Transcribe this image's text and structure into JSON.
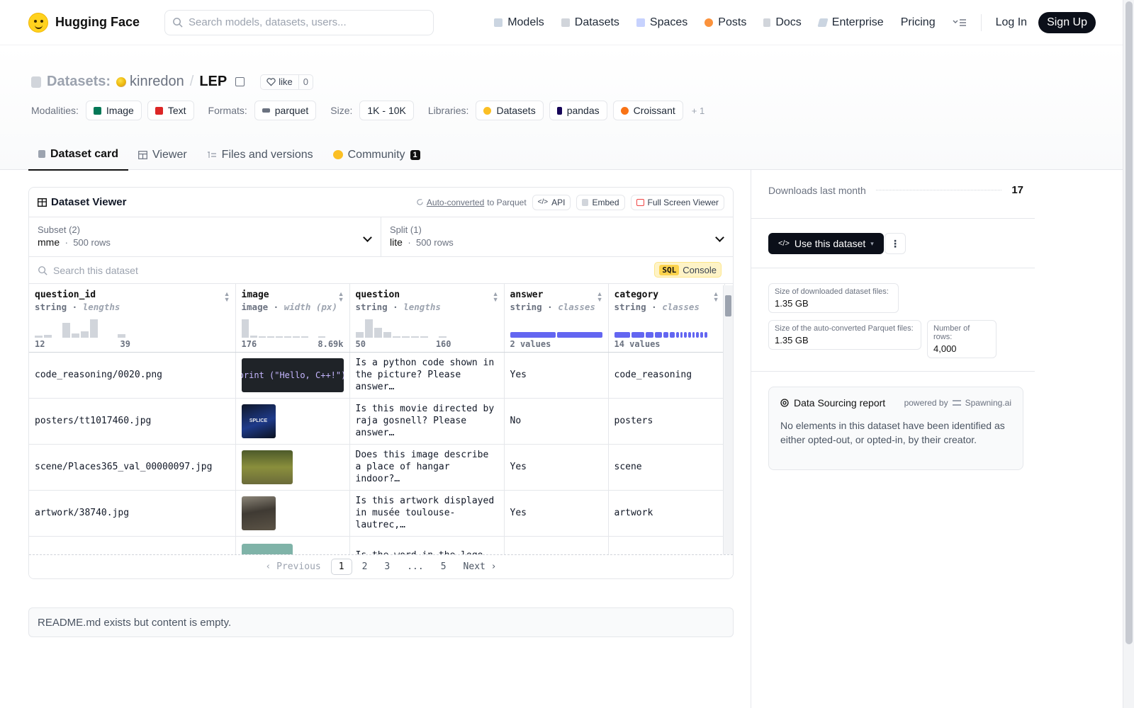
{
  "brand": {
    "name": "Hugging Face"
  },
  "search": {
    "placeholder": "Search models, datasets, users..."
  },
  "nav": {
    "items": [
      {
        "label": "Models",
        "color": "#a5b4fc"
      },
      {
        "label": "Datasets",
        "color": "#d1d5db"
      },
      {
        "label": "Spaces",
        "color": "#c7d2fe"
      },
      {
        "label": "Posts",
        "color": "#fb923c"
      },
      {
        "label": "Docs",
        "color": "#d1d5db"
      },
      {
        "label": "Enterprise",
        "color": "#cbd5e1"
      },
      {
        "label": "Pricing",
        "color": ""
      }
    ],
    "login": "Log In",
    "signup": "Sign Up"
  },
  "dataset": {
    "section": "Datasets:",
    "owner": "kinredon",
    "separator": "/",
    "name": "LEP",
    "like_label": "like",
    "likes": "0"
  },
  "tags": {
    "modalities_label": "Modalities:",
    "modalities": [
      "Image",
      "Text"
    ],
    "formats_label": "Formats:",
    "formats": [
      "parquet"
    ],
    "size_label": "Size:",
    "size": "1K - 10K",
    "libraries_label": "Libraries:",
    "libraries": [
      "Datasets",
      "pandas",
      "Croissant"
    ],
    "more": "+ 1"
  },
  "tabs": [
    {
      "label": "Dataset card",
      "active": true
    },
    {
      "label": "Viewer"
    },
    {
      "label": "Files and versions"
    },
    {
      "label": "Community",
      "badge": "1"
    }
  ],
  "viewer": {
    "title": "Dataset Viewer",
    "auto_converted": "Auto-converted",
    "to_parquet": "to Parquet",
    "api": "API",
    "embed": "Embed",
    "fullscreen": "Full Screen Viewer",
    "subset_label": "Subset (2)",
    "subset_value": "mme",
    "subset_rows": "500 rows",
    "split_label": "Split (1)",
    "split_value": "lite",
    "split_rows": "500 rows",
    "search_placeholder": "Search this dataset",
    "sql": "SQL",
    "console": "Console",
    "columns": [
      {
        "name": "question_id",
        "type": "string",
        "stat": "lengths",
        "min": "12",
        "max": "39"
      },
      {
        "name": "image",
        "type": "image",
        "stat": "width (px)",
        "min": "176",
        "max": "8.69k"
      },
      {
        "name": "question",
        "type": "string",
        "stat": "lengths",
        "min": "50",
        "max": "160"
      },
      {
        "name": "answer",
        "type": "string",
        "stat": "classes",
        "summary": "2 values"
      },
      {
        "name": "category",
        "type": "string",
        "stat": "classes",
        "summary": "14 values"
      }
    ],
    "rows": [
      {
        "question_id": "code_reasoning/0020.png",
        "image_text": "print (\"Hello, C++!\")",
        "question": "Is a python code shown in the picture? Please answer…",
        "answer": "Yes",
        "category": "code_reasoning"
      },
      {
        "question_id": "posters/tt1017460.jpg",
        "image_text": "SPLICE",
        "question": "Is this movie directed by raja gosnell? Please answer…",
        "answer": "No",
        "category": "posters"
      },
      {
        "question_id": "scene/Places365_val_00000097.jpg",
        "question": "Does this image describe a place of hangar indoor?…",
        "answer": "Yes",
        "category": "scene"
      },
      {
        "question_id": "artwork/38740.jpg",
        "question": "Is this artwork displayed in musée toulouse-lautrec,…",
        "answer": "Yes",
        "category": "artwork"
      },
      {
        "question_id": "",
        "question": "Is the word in the logo",
        "answer": "",
        "category": ""
      }
    ],
    "pagination": {
      "previous": "Previous",
      "pages": [
        "1",
        "2",
        "3",
        "...",
        "5"
      ],
      "current": "1",
      "next": "Next"
    }
  },
  "readme": "README.md exists but content is empty.",
  "sidebar": {
    "downloads_label": "Downloads last month",
    "downloads": "17",
    "use_button": "Use this dataset",
    "stats": [
      {
        "label": "Size of downloaded dataset files:",
        "value": "1.35 GB"
      },
      {
        "label": "Size of the auto-converted Parquet files:",
        "value": "1.35 GB"
      },
      {
        "label": "Number of rows:",
        "value": "4,000"
      }
    ],
    "report_title": "Data Sourcing report",
    "powered_by": "powered by",
    "powered_name": "Spawning.ai",
    "report_body": "No elements in this dataset have been identified as either opted-out, or opted-in, by their creator."
  }
}
